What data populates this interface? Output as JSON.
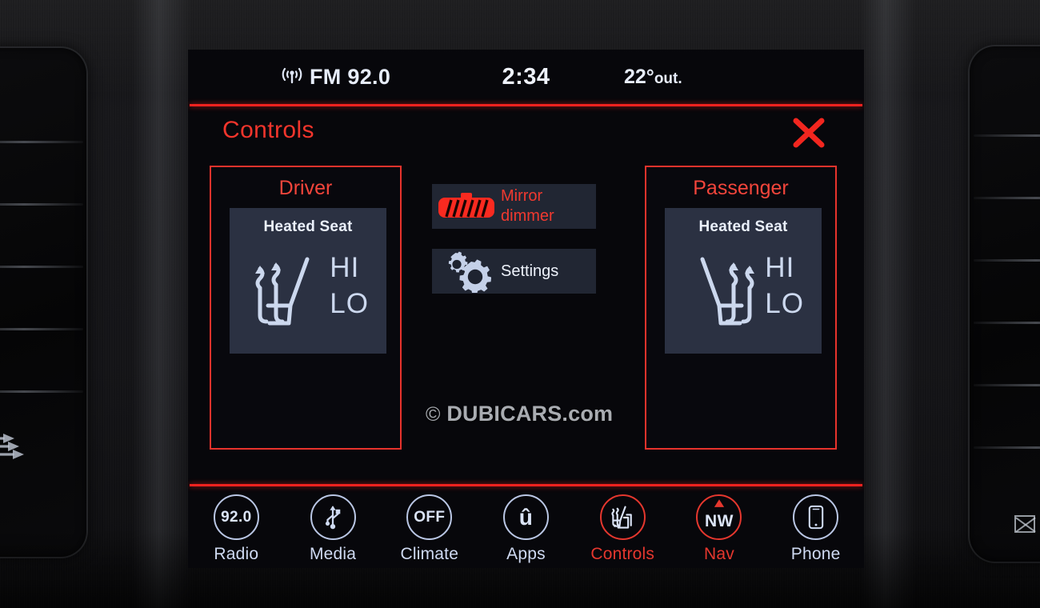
{
  "status_bar": {
    "signal_icon": "antenna-signal-icon",
    "radio_label": "FM 92.0",
    "clock": "2:34",
    "temperature": "22°",
    "temperature_suffix": "out."
  },
  "header": {
    "title": "Controls",
    "close_icon": "close-x-icon"
  },
  "zones": [
    {
      "id": "driver",
      "title": "Driver",
      "tile": {
        "label": "Heated Seat",
        "icon": "heated-seat-icon",
        "levels": [
          "HI",
          "LO"
        ]
      }
    },
    {
      "id": "passenger",
      "title": "Passenger",
      "tile": {
        "label": "Heated Seat",
        "icon": "heated-seat-icon",
        "levels": [
          "HI",
          "LO"
        ]
      }
    }
  ],
  "center_buttons": [
    {
      "id": "mirror-dimmer",
      "icon": "mirror-dimmer-icon",
      "line1": "Mirror",
      "line2": "dimmer",
      "state": "active",
      "color": "#f0392f"
    },
    {
      "id": "settings",
      "icon": "gears-icon",
      "line1": "Settings",
      "line2": "",
      "state": "inactive",
      "color": "#eef2fb"
    }
  ],
  "watermark": {
    "copyright": "©",
    "text": "DUBICARS.com"
  },
  "nav_bar": [
    {
      "id": "radio",
      "icon_text": "92.0",
      "icon": "radio-frequency-icon",
      "label": "Radio",
      "active": false
    },
    {
      "id": "media",
      "icon_text": "",
      "icon": "usb-icon",
      "label": "Media",
      "active": false
    },
    {
      "id": "climate",
      "icon_text": "OFF",
      "icon": "climate-off-icon",
      "label": "Climate",
      "active": false
    },
    {
      "id": "apps",
      "icon_text": "û",
      "icon": "uconnect-apps-icon",
      "label": "Apps",
      "active": false
    },
    {
      "id": "controls",
      "icon_text": "",
      "icon": "heated-seat-icon",
      "label": "Controls",
      "active": true
    },
    {
      "id": "nav",
      "icon_text": "NW",
      "icon": "compass-nav-icon",
      "label": "Nav",
      "active": true
    },
    {
      "id": "phone",
      "icon_text": "",
      "icon": "smartphone-icon",
      "label": "Phone",
      "active": false
    }
  ],
  "colors": {
    "accent_red": "#f2221f",
    "screen_bg": "#07070b",
    "tile_bg": "#2b3142",
    "text_blue": "#dbe4f7"
  },
  "vents": {
    "right_vent_icon": "closed-vent-icon"
  }
}
